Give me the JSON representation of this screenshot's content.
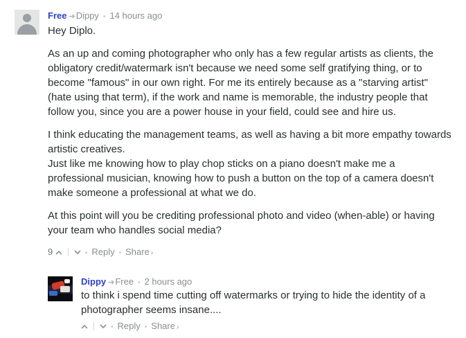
{
  "comments": [
    {
      "author": "Free",
      "in_reply_to": "Dippy",
      "time": "14 hours ago",
      "paragraphs": [
        [
          "Hey Diplo."
        ],
        [
          "As an up and coming photographer who only has a few regular artists as clients, the",
          "obligatory credit/watermark isn't because we need some self gratifying thing, or to",
          "become \"famous\" in our own right. For me its entirely because as a \"starving artist\"",
          "(hate using that term), if the work and name is memorable, the industry people that",
          "follow you, since you are a power house in your field, could see and hire us."
        ],
        [
          "I think educating the management teams, as well as having a bit more empathy towards",
          "artistic creatives.",
          "Just like me knowing how to play chop sticks on a piano doesn't make me a",
          "professional musician, knowing how to push a button on the top of a camera doesn't",
          "make someone a professional at what we do."
        ],
        [
          "At this point will you be crediting professional photo and video (when-able) or having",
          "your team who handles social media?"
        ]
      ],
      "upvotes": "9",
      "reply_label": "Reply",
      "share_label": "Share"
    },
    {
      "author": "Dippy",
      "in_reply_to": "Free",
      "time": "2 hours ago",
      "paragraphs": [
        [
          "to think i spend time cutting off watermarks or trying to hide the identity of a",
          "photographer seems insane...."
        ]
      ],
      "upvotes": "",
      "reply_label": "Reply",
      "share_label": "Share"
    }
  ],
  "icons": {
    "reply_arrow": "➔",
    "upvote": "up-chevron",
    "downvote": "down-chevron",
    "share_arrow": "›",
    "bullet": "•"
  },
  "colors": {
    "author": "#2e41c9",
    "meta": "#8a8e8f",
    "text": "#2a2e2e"
  }
}
